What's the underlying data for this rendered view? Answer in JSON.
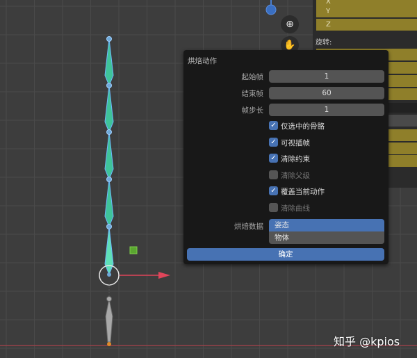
{
  "properties_panel": {
    "x_label": "X",
    "y_label": "Y",
    "z_label": "Z",
    "rotation_label": "旋转:"
  },
  "viewport_nav": {
    "zoom_icon": "zoom-in-icon",
    "pan_icon": "hand-icon"
  },
  "bake_dialog": {
    "title": "烘焙动作",
    "start_frame": {
      "label": "起始帧",
      "value": "1"
    },
    "end_frame": {
      "label": "结束帧",
      "value": "60"
    },
    "frame_step": {
      "label": "帧步长",
      "value": "1"
    },
    "options": [
      {
        "label": "仅选中的骨骼",
        "checked": true
      },
      {
        "label": "可视插帧",
        "checked": true
      },
      {
        "label": "清除约束",
        "checked": true
      },
      {
        "label": "清除父级",
        "checked": false
      },
      {
        "label": "覆盖当前动作",
        "checked": true
      },
      {
        "label": "清除曲线",
        "checked": false
      }
    ],
    "bake_data": {
      "label": "烘焙数据",
      "options": [
        "姿态",
        "物体"
      ],
      "selected": "姿态"
    },
    "ok_label": "确定"
  },
  "watermark": "知乎 @kpios",
  "colors": {
    "accent": "#4772b3",
    "field_yellow": "#8f7f2a",
    "bone_green": "#4fd6a0",
    "x_axis": "#d9404f"
  }
}
